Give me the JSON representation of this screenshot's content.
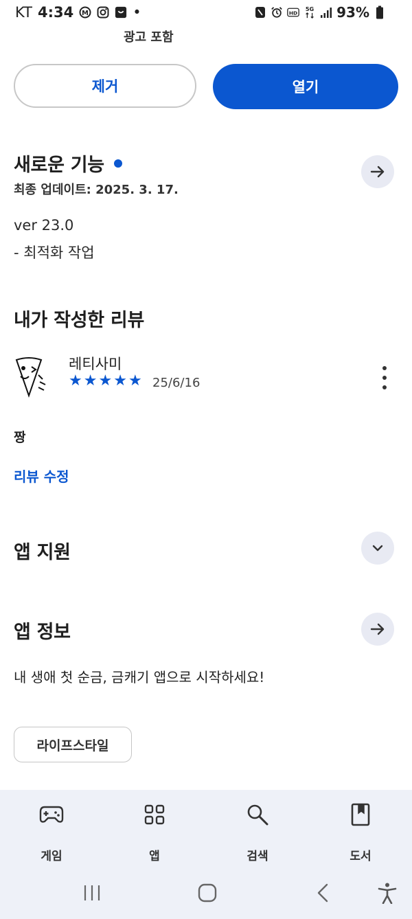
{
  "status_bar": {
    "carrier": "KT",
    "time": "4:34",
    "dot": "•",
    "battery_text": "93%",
    "left_icons": [
      "m-circle-icon",
      "instagram-icon",
      "shopping-bag-icon"
    ],
    "right_icons": [
      "nfc-icon",
      "alarm-icon",
      "hd-icon",
      "5g-icon",
      "signal-icon",
      "battery-icon"
    ]
  },
  "header": {
    "ads_note": "광고 포함"
  },
  "actions": {
    "remove_label": "제거",
    "open_label": "열기"
  },
  "whats_new": {
    "title": "새로운 기능",
    "updated": "최종 업데이트: 2025. 3. 17.",
    "version": "ver 23.0",
    "change": "- 최적화 작업"
  },
  "my_review": {
    "title": "내가 작성한 리뷰",
    "reviewer": "레티사미",
    "stars": 5,
    "date": "25/6/16",
    "text": "짱",
    "edit_label": "리뷰 수정"
  },
  "app_support": {
    "title": "앱 지원"
  },
  "app_info": {
    "title": "앱 정보",
    "description": "내 생애 첫 순금, 금캐기 앱으로 시작하세요!",
    "category_chip": "라이프스타일"
  },
  "bottom_nav": {
    "items": [
      {
        "label": "게임",
        "icon": "gamepad-icon"
      },
      {
        "label": "앱",
        "icon": "apps-grid-icon"
      },
      {
        "label": "검색",
        "icon": "search-icon"
      },
      {
        "label": "도서",
        "icon": "book-icon"
      }
    ]
  },
  "colors": {
    "accent": "#0b57d0",
    "nav_bg": "#eef1f8",
    "circle_btn_bg": "#e8eaf3"
  }
}
